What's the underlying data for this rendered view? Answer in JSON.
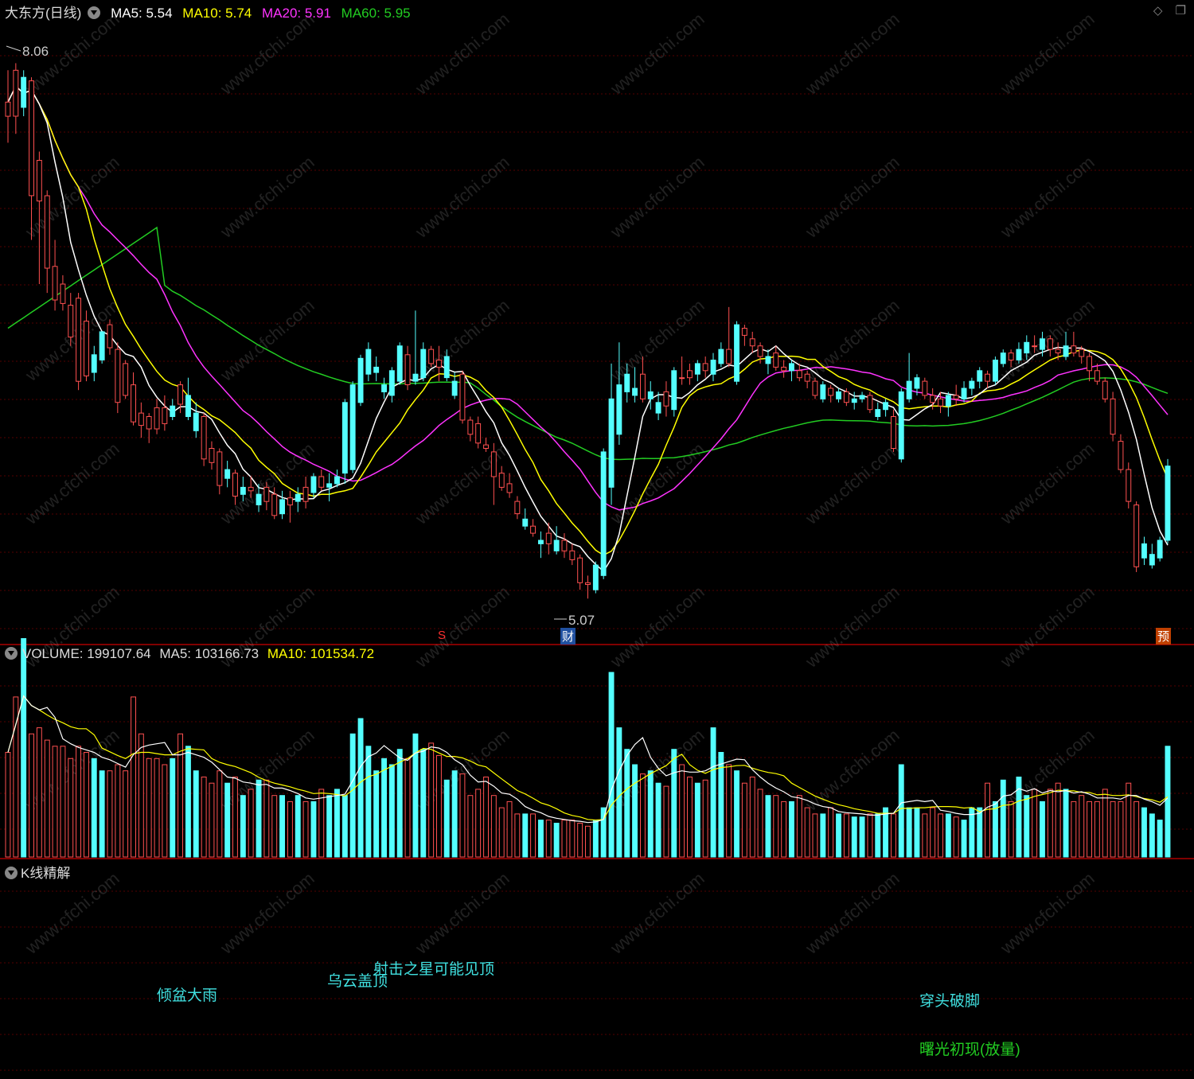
{
  "header": {
    "title": "大东方(日线)",
    "ma5": "MA5: 5.54",
    "ma10": "MA10: 5.74",
    "ma20": "MA20: 5.91",
    "ma60": "MA60: 5.95",
    "icons": [
      "diamond-icon",
      "restore-icon"
    ]
  },
  "volume_header": {
    "volume": "VOLUME: 199107.64",
    "ma5": "MA5: 103166.73",
    "ma10": "MA10: 101534.72"
  },
  "kline_panel": {
    "title": "K线精解"
  },
  "price_labels": {
    "high": "8.06",
    "low": "5.07"
  },
  "markers": {
    "s": "S",
    "cai": "财",
    "yu": "预"
  },
  "patterns": [
    {
      "text": "倾盆大雨",
      "color": "#40e0e0"
    },
    {
      "text": "乌云盖顶",
      "color": "#40e0e0"
    },
    {
      "text": "射击之星可能见顶",
      "color": "#40e0e0"
    },
    {
      "text": "穿头破脚",
      "color": "#40e0e0"
    },
    {
      "text": "曙光初现(放量)",
      "color": "#22cc22"
    }
  ],
  "watermark": "www.cfchi.com",
  "colors": {
    "up": "#ff5050",
    "down": "#54ffff",
    "ma5": "#ffffff",
    "ma10": "#ffff00",
    "ma20": "#ff33ff",
    "ma60": "#22cc22",
    "grid": "#550000",
    "axis": "#aa0000"
  },
  "chart_data": {
    "type": "candlestick",
    "price_range": [
      4.9,
      8.3
    ],
    "volume_range": [
      0,
      240000
    ],
    "candles": [
      [
        7.8,
        7.88,
        8.06,
        7.65,
        0.34
      ],
      [
        7.8,
        8.06,
        8.1,
        7.7,
        0.52
      ],
      [
        8.02,
        7.85,
        8.06,
        7.8,
        0.71
      ],
      [
        7.35,
        8.0,
        8.02,
        7.1,
        0.4
      ],
      [
        7.32,
        7.55,
        7.6,
        6.85,
        0.42
      ],
      [
        6.94,
        7.35,
        7.38,
        6.8,
        0.38
      ],
      [
        6.76,
        6.95,
        7.1,
        6.7,
        0.36
      ],
      [
        6.74,
        6.85,
        6.9,
        6.7,
        0.36
      ],
      [
        6.55,
        6.73,
        6.8,
        6.5,
        0.32
      ],
      [
        6.3,
        6.77,
        6.8,
        6.25,
        0.36
      ],
      [
        6.33,
        6.64,
        6.7,
        6.3,
        0.34
      ],
      [
        6.45,
        6.35,
        6.5,
        6.3,
        0.32
      ],
      [
        6.58,
        6.42,
        6.58,
        6.4,
        0.28
      ],
      [
        6.49,
        6.62,
        6.65,
        6.45,
        0.28
      ],
      [
        6.18,
        6.48,
        6.52,
        6.12,
        0.3
      ],
      [
        6.22,
        6.4,
        6.42,
        6.2,
        0.28
      ],
      [
        6.07,
        6.28,
        6.35,
        6.05,
        0.52
      ],
      [
        6.05,
        6.12,
        6.18,
        5.98,
        0.4
      ],
      [
        6.03,
        6.1,
        6.12,
        5.95,
        0.32
      ],
      [
        6.03,
        6.15,
        6.2,
        6.0,
        0.32
      ],
      [
        6.06,
        6.15,
        6.22,
        6.02,
        0.3
      ],
      [
        6.16,
        6.1,
        6.2,
        6.08,
        0.32
      ],
      [
        6.17,
        6.28,
        6.3,
        6.12,
        0.4
      ],
      [
        6.22,
        6.1,
        6.32,
        6.08,
        0.36
      ],
      [
        6.12,
        6.02,
        6.18,
        5.98,
        0.28
      ],
      [
        5.86,
        6.1,
        6.12,
        5.82,
        0.26
      ],
      [
        5.84,
        5.92,
        5.96,
        5.8,
        0.24
      ],
      [
        5.71,
        5.9,
        5.92,
        5.66,
        0.28
      ],
      [
        5.8,
        5.75,
        5.85,
        5.7,
        0.24
      ],
      [
        5.65,
        5.78,
        5.8,
        5.6,
        0.26
      ],
      [
        5.7,
        5.66,
        5.76,
        5.62,
        0.2
      ],
      [
        5.68,
        5.7,
        5.76,
        5.64,
        0.22
      ],
      [
        5.66,
        5.6,
        5.72,
        5.56,
        0.25
      ],
      [
        5.62,
        5.7,
        5.73,
        5.57,
        0.25
      ],
      [
        5.54,
        5.66,
        5.7,
        5.52,
        0.2
      ],
      [
        5.63,
        5.55,
        5.68,
        5.52,
        0.2
      ],
      [
        5.6,
        5.64,
        5.68,
        5.5,
        0.18
      ],
      [
        5.66,
        5.62,
        5.7,
        5.56,
        0.2
      ],
      [
        5.62,
        5.7,
        5.76,
        5.58,
        0.18
      ],
      [
        5.76,
        5.67,
        5.78,
        5.64,
        0.18
      ],
      [
        5.7,
        5.76,
        5.8,
        5.68,
        0.22
      ],
      [
        5.72,
        5.7,
        5.78,
        5.62,
        0.2
      ],
      [
        5.76,
        5.72,
        5.8,
        5.7,
        0.22
      ],
      [
        6.18,
        5.78,
        6.2,
        5.72,
        0.2
      ],
      [
        6.28,
        5.8,
        6.3,
        5.78,
        0.4
      ],
      [
        6.43,
        6.18,
        6.45,
        6.16,
        0.45
      ],
      [
        6.48,
        6.34,
        6.52,
        6.3,
        0.36
      ],
      [
        6.38,
        6.35,
        6.44,
        6.3,
        0.28
      ],
      [
        6.28,
        6.24,
        6.32,
        6.2,
        0.32
      ],
      [
        6.36,
        6.22,
        6.38,
        6.18,
        0.3
      ],
      [
        6.5,
        6.3,
        6.52,
        6.28,
        0.35
      ],
      [
        6.28,
        6.45,
        6.5,
        6.25,
        0.32
      ],
      [
        6.34,
        6.3,
        6.7,
        6.28,
        0.4
      ],
      [
        6.48,
        6.32,
        6.52,
        6.3,
        0.35
      ],
      [
        6.4,
        6.48,
        6.5,
        6.38,
        0.37
      ],
      [
        6.38,
        6.42,
        6.5,
        6.3,
        0.33
      ],
      [
        6.44,
        6.32,
        6.48,
        6.3,
        0.25
      ],
      [
        6.3,
        6.22,
        6.35,
        6.2,
        0.28
      ],
      [
        6.08,
        6.34,
        6.36,
        6.06,
        0.27
      ],
      [
        6.0,
        6.08,
        6.1,
        5.96,
        0.2
      ],
      [
        5.95,
        6.06,
        6.1,
        5.92,
        0.22
      ],
      [
        5.92,
        5.94,
        5.98,
        5.9,
        0.26
      ],
      [
        5.76,
        5.9,
        5.95,
        5.6,
        0.2
      ],
      [
        5.7,
        5.78,
        5.82,
        5.68,
        0.16
      ],
      [
        5.67,
        5.72,
        5.78,
        5.64,
        0.18
      ],
      [
        5.55,
        5.62,
        5.65,
        5.52,
        0.14
      ],
      [
        5.52,
        5.48,
        5.58,
        5.46,
        0.14
      ],
      [
        5.44,
        5.48,
        5.52,
        5.42,
        0.14
      ],
      [
        5.4,
        5.38,
        5.45,
        5.3,
        0.12
      ],
      [
        5.38,
        5.44,
        5.5,
        5.32,
        0.12
      ],
      [
        5.4,
        5.34,
        5.48,
        5.32,
        0.11
      ],
      [
        5.34,
        5.4,
        5.44,
        5.3,
        0.12
      ],
      [
        5.29,
        5.34,
        5.38,
        5.26,
        0.12
      ],
      [
        5.16,
        5.3,
        5.32,
        5.12,
        0.11
      ],
      [
        5.15,
        5.16,
        5.2,
        5.07,
        0.1
      ],
      [
        5.26,
        5.12,
        5.28,
        5.1,
        0.12
      ],
      [
        5.9,
        5.2,
        5.92,
        5.18,
        0.16
      ],
      [
        6.2,
        5.7,
        6.4,
        5.6,
        0.6
      ],
      [
        6.28,
        6.0,
        6.52,
        5.94,
        0.42
      ],
      [
        6.34,
        6.24,
        6.4,
        6.18,
        0.35
      ],
      [
        6.26,
        6.22,
        6.38,
        6.18,
        0.3
      ],
      [
        6.2,
        6.34,
        6.44,
        6.18,
        0.27
      ],
      [
        6.24,
        6.2,
        6.3,
        6.14,
        0.28
      ],
      [
        6.18,
        6.12,
        6.24,
        6.08,
        0.24
      ],
      [
        6.16,
        6.24,
        6.3,
        6.1,
        0.23
      ],
      [
        6.36,
        6.14,
        6.38,
        6.1,
        0.35
      ],
      [
        6.32,
        6.32,
        6.44,
        6.28,
        0.3
      ],
      [
        6.32,
        6.36,
        6.4,
        6.28,
        0.26
      ],
      [
        6.4,
        6.34,
        6.42,
        6.3,
        0.24
      ],
      [
        6.36,
        6.4,
        6.44,
        6.32,
        0.25
      ],
      [
        6.42,
        6.34,
        6.46,
        6.3,
        0.42
      ],
      [
        6.48,
        6.4,
        6.52,
        6.38,
        0.34
      ],
      [
        6.4,
        6.48,
        6.72,
        6.38,
        0.3
      ],
      [
        6.62,
        6.3,
        6.64,
        6.28,
        0.28
      ],
      [
        6.56,
        6.6,
        6.62,
        6.5,
        0.24
      ],
      [
        6.5,
        6.54,
        6.58,
        6.46,
        0.26
      ],
      [
        6.44,
        6.5,
        6.52,
        6.4,
        0.22
      ],
      [
        6.44,
        6.4,
        6.48,
        6.34,
        0.2
      ],
      [
        6.38,
        6.46,
        6.5,
        6.36,
        0.2
      ],
      [
        6.36,
        6.38,
        6.42,
        6.32,
        0.18
      ],
      [
        6.4,
        6.36,
        6.42,
        6.3,
        0.18
      ],
      [
        6.32,
        6.36,
        6.4,
        6.3,
        0.2
      ],
      [
        6.3,
        6.34,
        6.36,
        6.26,
        0.16
      ],
      [
        6.22,
        6.3,
        6.32,
        6.2,
        0.14
      ],
      [
        6.28,
        6.2,
        6.3,
        6.18,
        0.14
      ],
      [
        6.22,
        6.26,
        6.28,
        6.18,
        0.16
      ],
      [
        6.24,
        6.2,
        6.26,
        6.18,
        0.14
      ],
      [
        6.18,
        6.24,
        6.26,
        6.16,
        0.14
      ],
      [
        6.2,
        6.18,
        6.24,
        6.14,
        0.13
      ],
      [
        6.22,
        6.2,
        6.24,
        6.18,
        0.13
      ],
      [
        6.14,
        6.22,
        6.24,
        6.12,
        0.14
      ],
      [
        6.14,
        6.1,
        6.18,
        6.08,
        0.14
      ],
      [
        6.18,
        6.14,
        6.2,
        6.1,
        0.16
      ],
      [
        5.92,
        6.1,
        6.14,
        5.9,
        0.14
      ],
      [
        6.24,
        5.86,
        6.26,
        5.84,
        0.3
      ],
      [
        6.3,
        6.2,
        6.46,
        6.18,
        0.16
      ],
      [
        6.32,
        6.26,
        6.34,
        6.22,
        0.16
      ],
      [
        6.22,
        6.3,
        6.32,
        6.2,
        0.14
      ],
      [
        6.18,
        6.22,
        6.26,
        6.14,
        0.16
      ],
      [
        6.16,
        6.2,
        6.24,
        6.12,
        0.14
      ],
      [
        6.22,
        6.16,
        6.24,
        6.1,
        0.14
      ],
      [
        6.2,
        6.22,
        6.28,
        6.16,
        0.13
      ],
      [
        6.26,
        6.2,
        6.3,
        6.18,
        0.12
      ],
      [
        6.3,
        6.26,
        6.32,
        6.22,
        0.16
      ],
      [
        6.36,
        6.3,
        6.38,
        6.26,
        0.16
      ],
      [
        6.3,
        6.34,
        6.36,
        6.26,
        0.24
      ],
      [
        6.42,
        6.3,
        6.44,
        6.28,
        0.18
      ],
      [
        6.46,
        6.4,
        6.48,
        6.38,
        0.25
      ],
      [
        6.42,
        6.46,
        6.48,
        6.38,
        0.18
      ],
      [
        6.48,
        6.42,
        6.52,
        6.4,
        0.26
      ],
      [
        6.52,
        6.46,
        6.56,
        6.42,
        0.2
      ],
      [
        6.5,
        6.5,
        6.56,
        6.46,
        0.22
      ],
      [
        6.54,
        6.48,
        6.58,
        6.44,
        0.18
      ],
      [
        6.48,
        6.54,
        6.56,
        6.44,
        0.22
      ],
      [
        6.46,
        6.48,
        6.52,
        6.42,
        0.24
      ],
      [
        6.5,
        6.44,
        6.58,
        6.42,
        0.22
      ],
      [
        6.46,
        6.5,
        6.58,
        6.44,
        0.18
      ],
      [
        6.44,
        6.48,
        6.5,
        6.4,
        0.2
      ],
      [
        6.36,
        6.44,
        6.46,
        6.3,
        0.18
      ],
      [
        6.3,
        6.36,
        6.4,
        6.28,
        0.18
      ],
      [
        6.2,
        6.3,
        6.32,
        6.18,
        0.22
      ],
      [
        6.0,
        6.2,
        6.24,
        5.96,
        0.18
      ],
      [
        5.8,
        5.96,
        6.0,
        5.78,
        0.18
      ],
      [
        5.62,
        5.8,
        5.84,
        5.58,
        0.24
      ],
      [
        5.25,
        5.6,
        5.62,
        5.22,
        0.18
      ],
      [
        5.38,
        5.3,
        5.42,
        5.26,
        0.16
      ],
      [
        5.32,
        5.26,
        5.38,
        5.24,
        0.14
      ],
      [
        5.4,
        5.3,
        5.42,
        5.28,
        0.12
      ],
      [
        5.82,
        5.4,
        5.86,
        5.38,
        0.36
      ]
    ]
  }
}
